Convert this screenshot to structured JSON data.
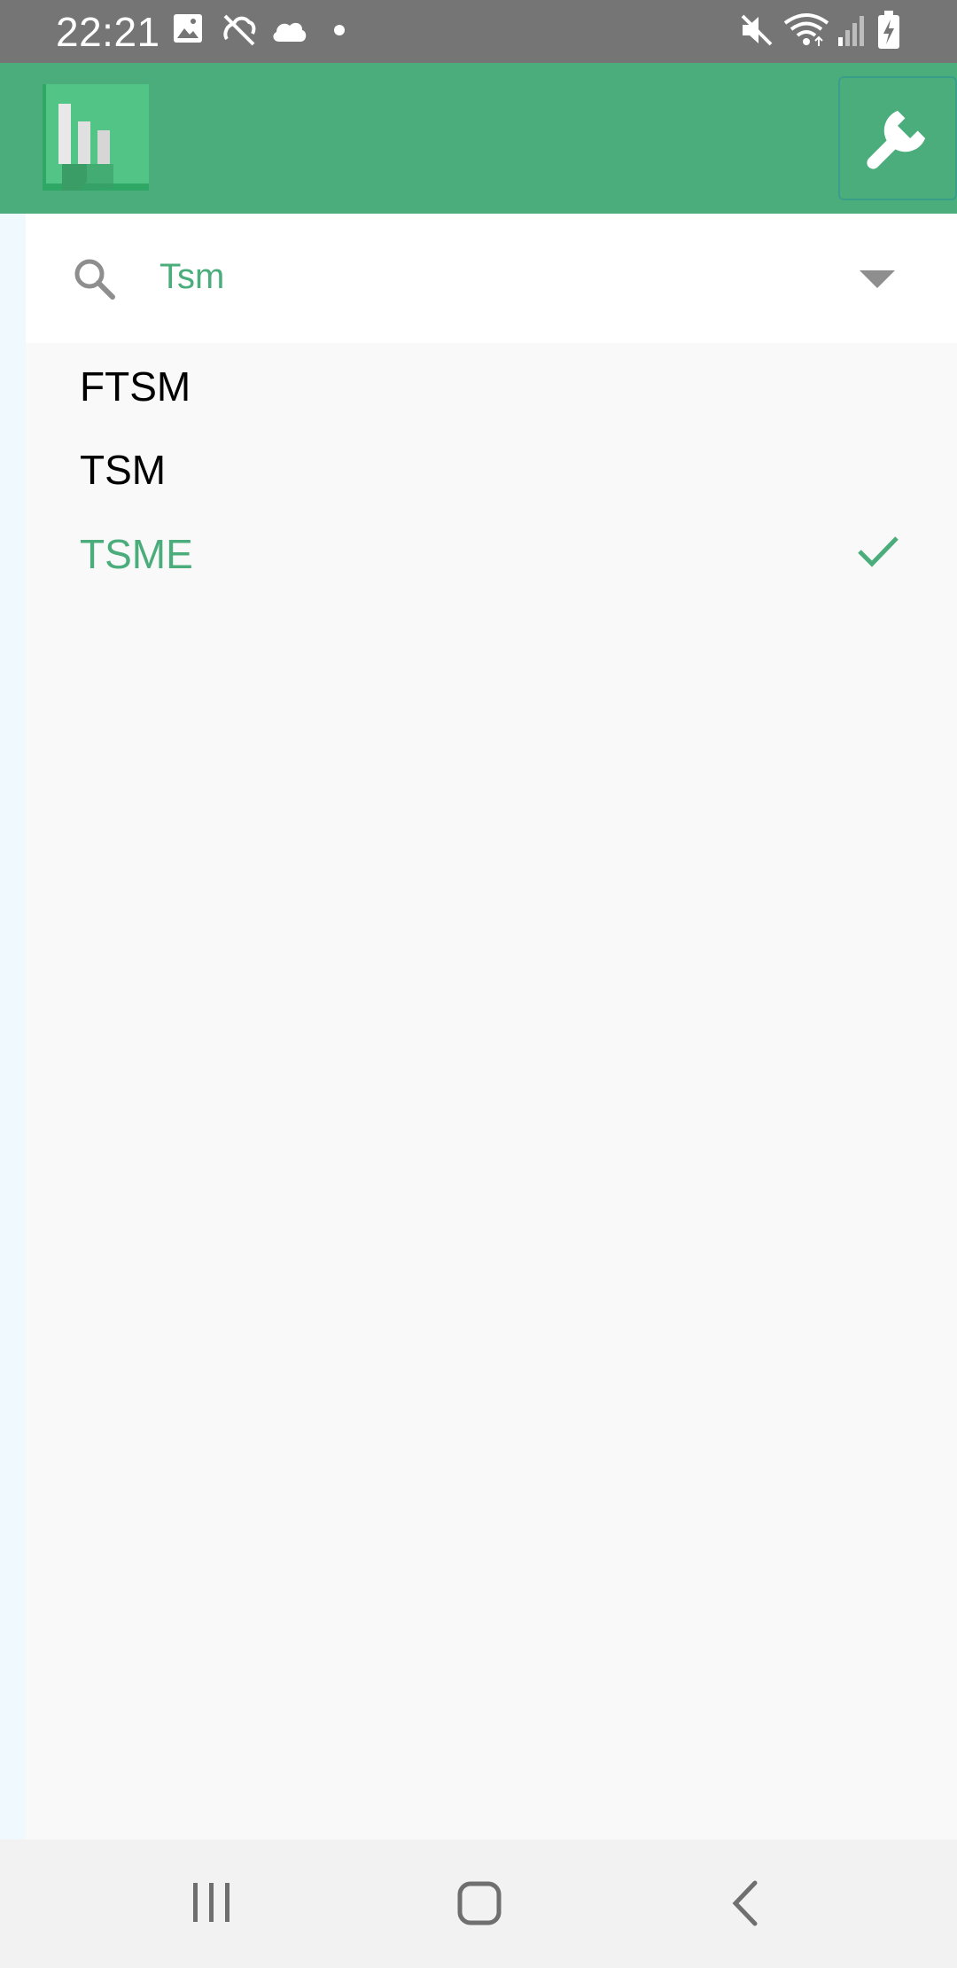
{
  "status_bar": {
    "time": "22:21",
    "icons_left": [
      "image-icon",
      "sync-off-icon",
      "cloud-icon",
      "dot-icon"
    ],
    "icons_right": [
      "mute-icon",
      "wifi-icon",
      "signal-icon",
      "battery-charging-icon"
    ]
  },
  "app_bar": {
    "background": "#4aad7b",
    "logo_icon": "bar-chart-logo-icon",
    "settings_icon": "wrench-icon"
  },
  "search": {
    "icon": "search-icon",
    "value": "Tsm",
    "dropdown_icon": "triangle-down-icon"
  },
  "options": [
    {
      "label": "FTSM",
      "selected": false
    },
    {
      "label": "TSM",
      "selected": false
    },
    {
      "label": "TSME",
      "selected": true
    }
  ],
  "colors": {
    "accent": "#4aad7b",
    "status_bar": "#757575",
    "panel": "#f9f9f9",
    "nav_bar": "#f2f2f2"
  },
  "nav_bar": {
    "buttons": [
      "recent-apps-icon",
      "home-icon",
      "back-icon"
    ]
  }
}
